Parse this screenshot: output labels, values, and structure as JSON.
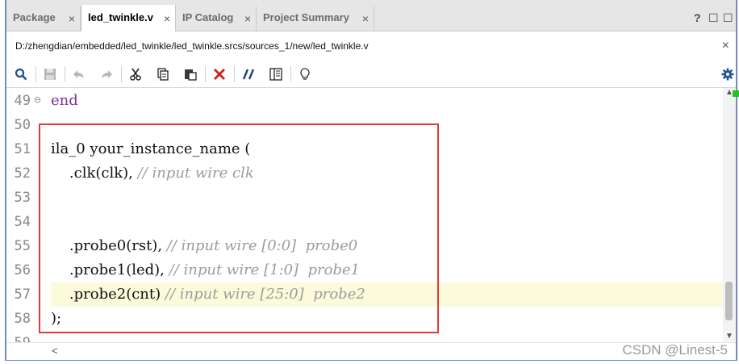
{
  "tabs": [
    {
      "label": "Package",
      "active": false
    },
    {
      "label": "led_twinkle.v",
      "active": true
    },
    {
      "label": "IP Catalog",
      "active": false
    },
    {
      "label": "Project Summary",
      "active": false
    }
  ],
  "tab_close_glyph": "×",
  "window_controls": {
    "help": "?",
    "restore": "☐",
    "maximize": "☐"
  },
  "file_path": "D:/zhengdian/embedded/led_twinkle/led_twinkle.srcs/sources_1/new/led_twinkle.v",
  "toolbar_icons": [
    "search-icon",
    "save-icon",
    "undo-icon",
    "redo-icon",
    "cut-icon",
    "copy-icon",
    "paste-icon",
    "delete-icon",
    "comment-icon",
    "column-icon",
    "lightbulb-icon",
    "settings-icon"
  ],
  "colors": {
    "accent_border": "#6b8ec7",
    "highlight_box": "#e03a3a",
    "keyword": "#7b2fa0",
    "comment": "#9c9c9c",
    "current_line": "#fbfbdc"
  },
  "editor": {
    "lines": [
      {
        "num": "49",
        "code": "end",
        "comment": ""
      },
      {
        "num": "50",
        "code": "",
        "comment": ""
      },
      {
        "num": "51",
        "code": "ila_0 your_instance_name (",
        "comment": ""
      },
      {
        "num": "52",
        "code": "    .clk(clk),",
        "comment": "// input wire clk"
      },
      {
        "num": "53",
        "code": "",
        "comment": ""
      },
      {
        "num": "54",
        "code": "",
        "comment": ""
      },
      {
        "num": "55",
        "code": "    .probe0(rst),",
        "comment": "// input wire [0:0]  probe0"
      },
      {
        "num": "56",
        "code": "    .probe1(led),",
        "comment": "// input wire [1:0]  probe1"
      },
      {
        "num": "57",
        "code": "    .probe2(cnt)",
        "comment": "// input wire [25:0]  probe2"
      },
      {
        "num": "58",
        "code": ");",
        "comment": ""
      },
      {
        "num": "59",
        "code": "",
        "comment": ""
      }
    ]
  },
  "scroll_left_glyph": "<",
  "watermark": "CSDN @Linest-5"
}
